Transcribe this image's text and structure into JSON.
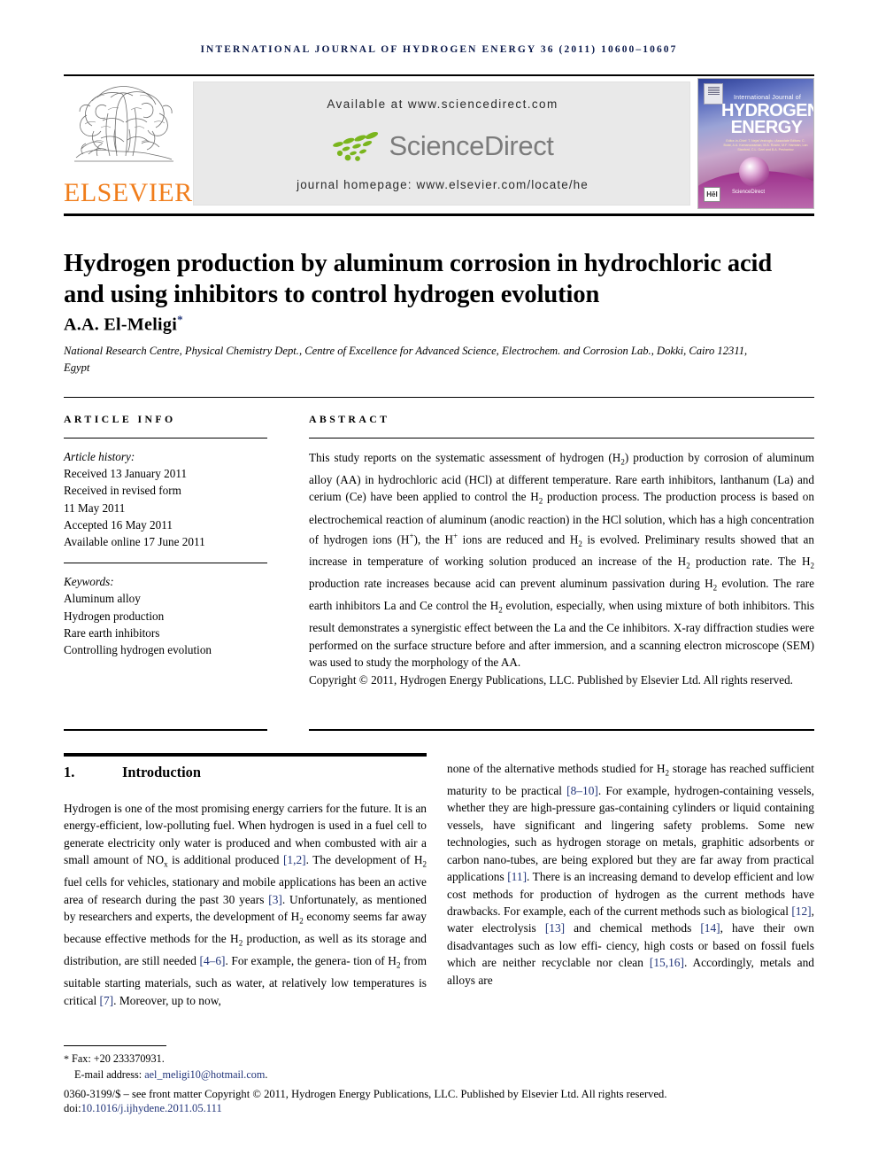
{
  "running_head": "INTERNATIONAL JOURNAL OF HYDROGEN ENERGY 36 (2011) 10600–10607",
  "masthead": {
    "elsevier_wordmark": "ELSEVIER",
    "available_at": "Available at www.sciencedirect.com",
    "sciencedirect_wordmark": "ScienceDirect",
    "journal_homepage": "journal homepage: www.elsevier.com/locate/he",
    "cover": {
      "line_small": "International Journal of",
      "line1": "HYDROGEN",
      "line2": "ENERGY",
      "editors": "Editor-in-Chief: T. Nejat Veziroglu • Associate Editors: C. Bolat, A.A. Kamaruzzaman, M.A. Rosen, M.F. Hamdan, Lan Stanford, C.L. Ozel and B.A. Peshantov",
      "hei_badge": "HēI",
      "sciencedirect_small": "ScienceDirect"
    }
  },
  "title": "Hydrogen production by aluminum corrosion in hydrochloric acid and using inhibitors to control hydrogen evolution",
  "author": "A.A. El-Meligi",
  "author_marker": "*",
  "affiliation": "National Research Centre, Physical Chemistry Dept., Centre of Excellence for Advanced Science, Electrochem. and Corrosion Lab., Dokki, Cairo 12311, Egypt",
  "article_info": {
    "heading": "ARTICLE INFO",
    "history_label": "Article history:",
    "history": [
      "Received 13 January 2011",
      "Received in revised form",
      "11 May 2011",
      "Accepted 16 May 2011",
      "Available online 17 June 2011"
    ],
    "keywords_label": "Keywords:",
    "keywords": [
      "Aluminum alloy",
      "Hydrogen production",
      "Rare earth inhibitors",
      "Controlling hydrogen evolution"
    ]
  },
  "abstract": {
    "heading": "ABSTRACT",
    "body": "This study reports on the systematic assessment of hydrogen (H2) production by corrosion of aluminum alloy (AA) in hydrochloric acid (HCl) at different temperature. Rare earth inhibitors, lanthanum (La) and cerium (Ce) have been applied to control the H2 production process. The production process is based on electrochemical reaction of aluminum (anodic reaction) in the HCl solution, which has a high concentration of hydrogen ions (H+), the H+ ions are reduced and H2 is evolved. Preliminary results showed that an increase in temperature of working solution produced an increase of the H2 production rate. The H2 production rate increases because acid can prevent aluminum passivation during H2 evolution. The rare earth inhibitors La and Ce control the H2 evolution, especially, when using mixture of both inhibitors. This result demonstrates a synergistic effect between the La and the Ce inhibitors. X-ray diffraction studies were performed on the surface structure before and after immersion, and a scanning electron microscope (SEM) was used to study the morphology of the AA.",
    "copyright": "Copyright © 2011, Hydrogen Energy Publications, LLC. Published by Elsevier Ltd. All rights reserved."
  },
  "section": {
    "number": "1.",
    "title": "Introduction",
    "left_paragraph": "Hydrogen is one of the most promising energy carriers for the future. It is an energy-efficient, low-polluting fuel. When hydrogen is used in a fuel cell to generate electricity only water is produced and when combusted with air a small amount of NOx is additional produced [1,2]. The development of H2 fuel cells for vehicles, stationary and mobile applications has been an active area of research during the past 30 years [3]. Unfortunately, as mentioned by researchers and experts, the development of H2 economy seems far away because effective methods for the H2 production, as well as its storage and distribution, are still needed [4–6]. For example, the generation of H2 from suitable starting materials, such as water, at relatively low temperatures is critical [7]. Moreover, up to now,",
    "right_paragraph": "none of the alternative methods studied for H2 storage has reached sufficient maturity to be practical [8–10]. For example, hydrogen-containing vessels, whether they are high-pressure gas-containing cylinders or liquid containing vessels, have significant and lingering safety problems. Some new technologies, such as hydrogen storage on metals, graphitic adsorbents or carbon nano-tubes, are being explored but they are far away from practical applications [11]. There is an increasing demand to develop efficient and low cost methods for production of hydrogen as the current methods have drawbacks. For example, each of the current methods such as biological [12], water electrolysis [13] and chemical methods [14], have their own disadvantages such as low efficiency, high costs or based on fossil fuels which are neither recyclable nor clean [15,16]. Accordingly, metals and alloys are"
  },
  "footer": {
    "fax": "Fax: +20 233370931.",
    "email_label": "E-mail address:",
    "email": "ael_meligi10@hotmail.com",
    "issn_line": "0360-3199/$ – see front matter Copyright © 2011, Hydrogen Energy Publications, LLC. Published by Elsevier Ltd. All rights reserved.",
    "doi_label": "doi:",
    "doi": "10.1016/j.ijhydene.2011.05.111"
  },
  "colors": {
    "running_head": "#0d1b4c",
    "elsevier_orange": "#F07D1B",
    "sciencedirect_green": "#7ab51d",
    "sciencedirect_gray": "#7b7b7b",
    "reference_link": "#22357a",
    "banner_bg": "#e9e9e9"
  }
}
